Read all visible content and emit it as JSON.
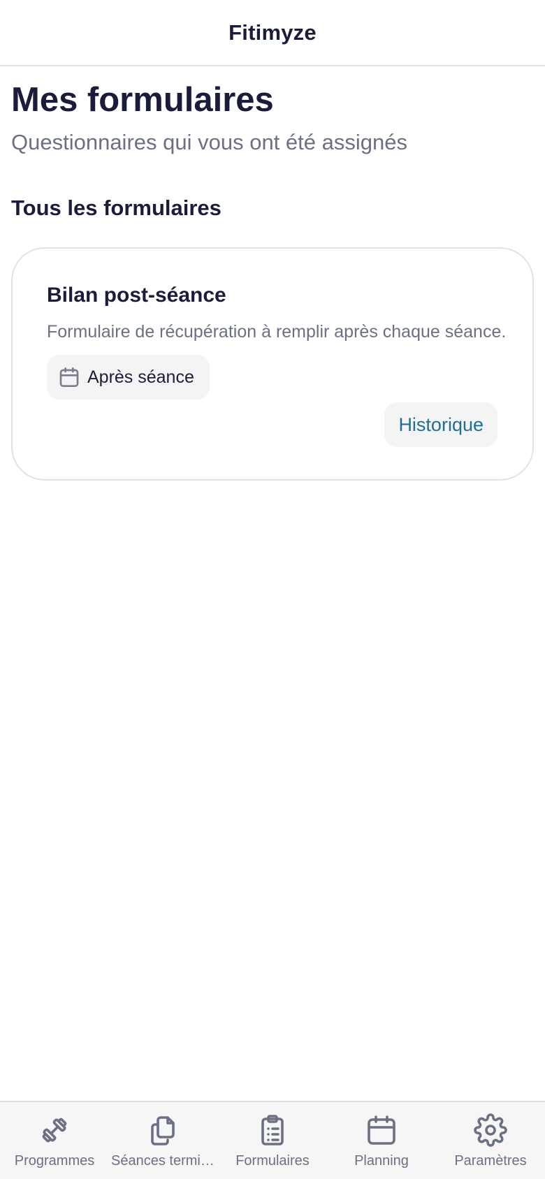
{
  "header": {
    "title": "Fitimyze"
  },
  "page": {
    "title": "Mes formulaires",
    "subtitle": "Questionnaires qui vous ont été assignés"
  },
  "section": {
    "title": "Tous les formulaires"
  },
  "forms": [
    {
      "title": "Bilan post-séance",
      "description": "Formulaire de récupération à remplir après chaque séance.",
      "badge": {
        "icon": "calendar-icon",
        "label": "Après séance"
      },
      "history_label": "Historique"
    }
  ],
  "tab_bar": {
    "items": [
      {
        "icon": "dumbbell-icon",
        "label": "Programmes"
      },
      {
        "icon": "copy-icon",
        "label": "Séances termin..."
      },
      {
        "icon": "clipboard-list-icon",
        "label": "Formulaires"
      },
      {
        "icon": "calendar-icon",
        "label": "Planning"
      },
      {
        "icon": "gear-icon",
        "label": "Paramètres"
      }
    ]
  },
  "colors": {
    "text_primary": "#1a1d3a",
    "text_secondary": "#6b7182",
    "link": "#1f6f92",
    "chip_background": "#f4f4f5",
    "border": "#e2e3e7"
  }
}
